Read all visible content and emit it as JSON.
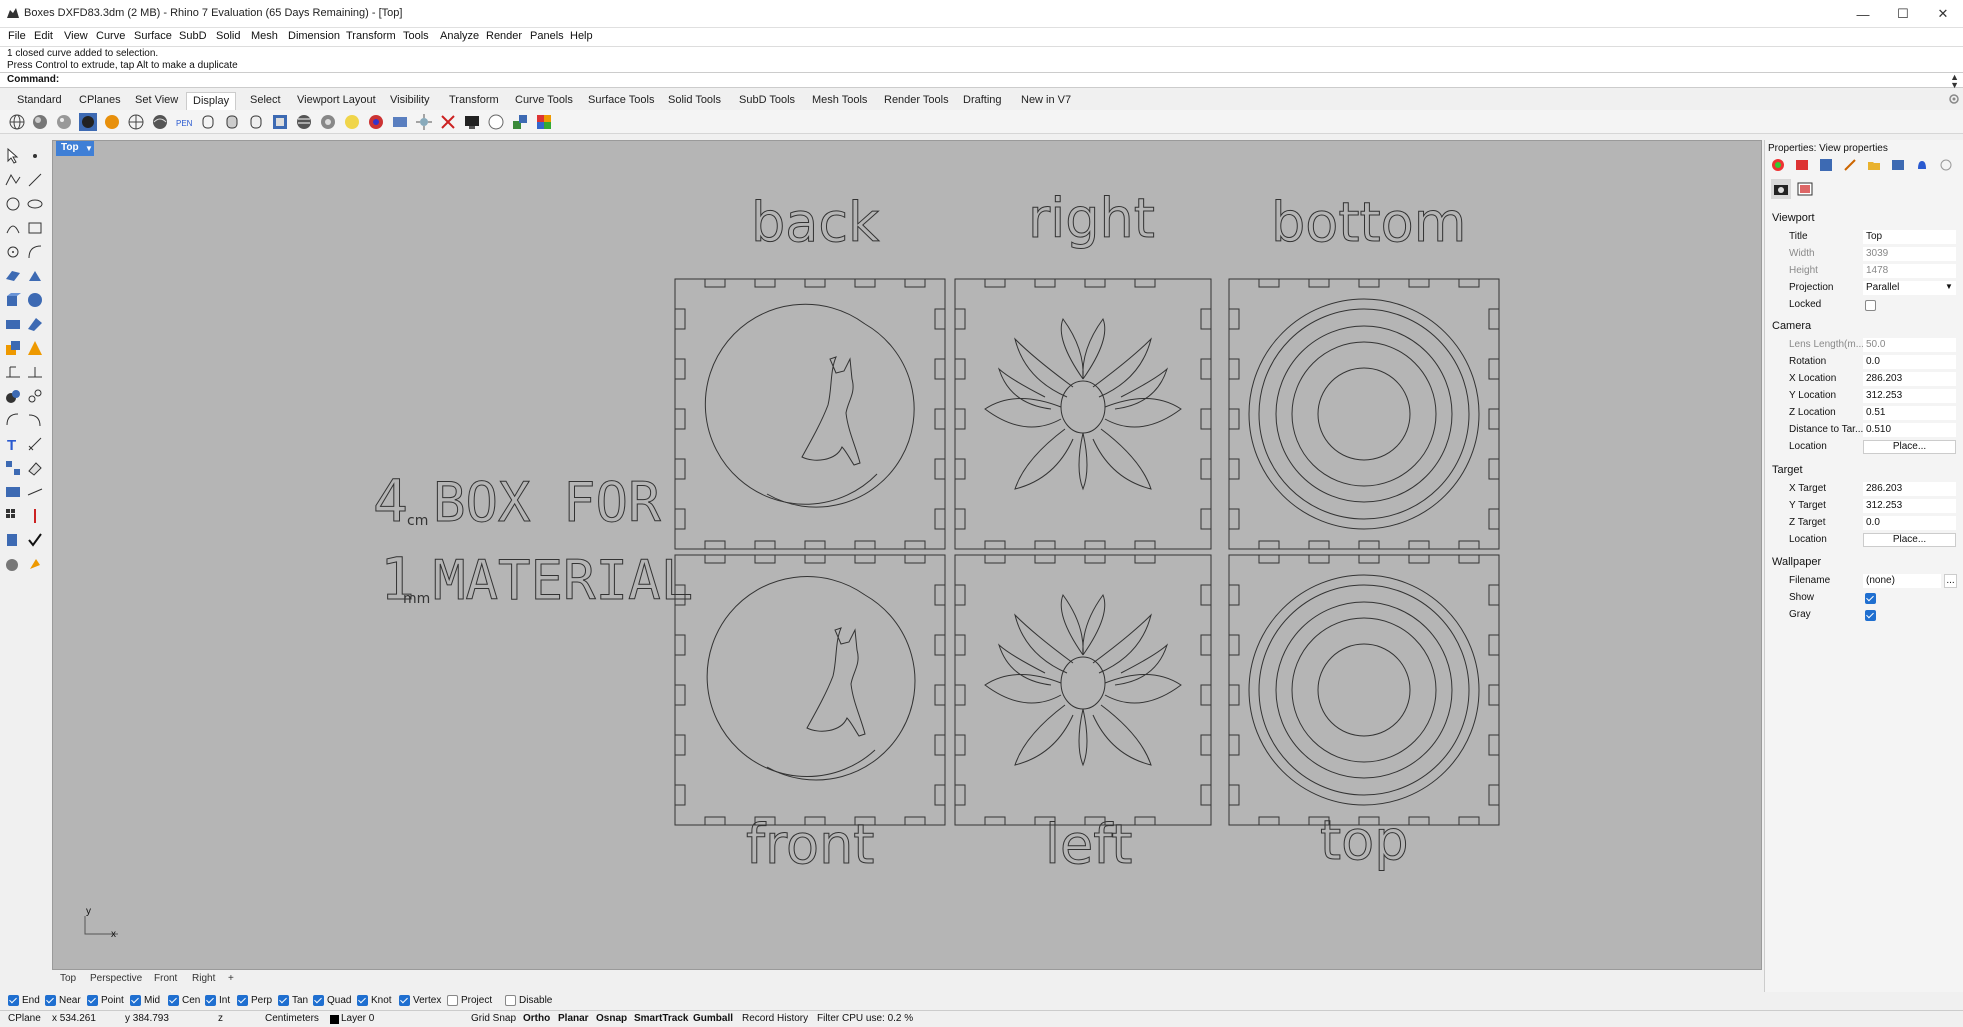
{
  "window": {
    "title": "Boxes DXFD83.3dm (2 MB) - Rhino 7 Evaluation (65 Days Remaining) - [Top]",
    "controls": {
      "minimize": "—",
      "maximize": "☐",
      "close": "✕"
    }
  },
  "menu": [
    "File",
    "Edit",
    "View",
    "Curve",
    "Surface",
    "SubD",
    "Solid",
    "Mesh",
    "Dimension",
    "Transform",
    "Tools",
    "Analyze",
    "Render",
    "Panels",
    "Help"
  ],
  "history": [
    "1 closed curve added to selection.",
    "Press Control to extrude, tap Alt to make a duplicate"
  ],
  "command": {
    "label": "Command:",
    "value": ""
  },
  "toolbar_tabs": [
    "Standard",
    "CPlanes",
    "Set View",
    "Display",
    "Select",
    "Viewport Layout",
    "Visibility",
    "Transform",
    "Curve Tools",
    "Surface Tools",
    "Solid Tools",
    "SubD Tools",
    "Mesh Tools",
    "Render Tools",
    "Drafting",
    "New in V7"
  ],
  "active_toolbar_tab": "Display",
  "toolbar_icons": [
    "wireframe-icon",
    "shaded-icon",
    "rendered-icon",
    "ghosted-icon",
    "xray-icon",
    "technical-icon",
    "artistic-icon",
    "pen-icon",
    "arctic-icon",
    "monochrome-icon",
    "toggle-shade-icon",
    "object-display-icon",
    "zebra-icon",
    "env-map-icon",
    "draft-angle-icon",
    "curvature-icon",
    "emap-icon",
    "light-icon",
    "spotlight-icon",
    "sun-icon",
    "camera-icon",
    "gumball-icon",
    "delete-view-icon",
    "display-monitor-icon",
    "capture-icon",
    "render-icon",
    "material-icon"
  ],
  "left_tools": [
    "select-icon",
    "point-icon",
    "polyline-icon",
    "line-icon",
    "circle-icon",
    "ellipse-icon",
    "arc-icon",
    "rectangle-icon",
    "polygon-icon",
    "curve-icon",
    "surface-icon",
    "loft-icon",
    "box-icon",
    "sphere-icon",
    "extrude-icon",
    "mesh-icon",
    "fillet-icon",
    "offset-icon",
    "trim-icon",
    "split-icon",
    "join-icon",
    "explode-icon",
    "boolean-icon",
    "move-icon",
    "rotate-icon",
    "scale-icon",
    "text-icon",
    "dimension-icon",
    "group-icon",
    "block-icon",
    "array-icon",
    "orient-icon",
    "layer-icon",
    "properties-icon",
    "check-icon",
    "analyze-icon",
    "render-icon",
    "paint-icon"
  ],
  "viewport": {
    "title": "Top",
    "labels": {
      "back": "back",
      "right": "right",
      "bottom": "bottom",
      "front": "front",
      "left": "left",
      "top": "top"
    },
    "box_text": {
      "n1": "4",
      "u1": "cm",
      "t1": "BOX FOR",
      "n2": "1",
      "u2": "mm",
      "t2": "MATERIAL"
    },
    "axis": {
      "y": "y",
      "x": "x"
    }
  },
  "viewport_tabs": [
    "Top",
    "Perspective",
    "Front",
    "Right"
  ],
  "viewport_add": "+",
  "snaps": [
    {
      "label": "End",
      "on": true
    },
    {
      "label": "Near",
      "on": true
    },
    {
      "label": "Point",
      "on": true
    },
    {
      "label": "Mid",
      "on": true
    },
    {
      "label": "Cen",
      "on": true
    },
    {
      "label": "Int",
      "on": true
    },
    {
      "label": "Perp",
      "on": true
    },
    {
      "label": "Tan",
      "on": true
    },
    {
      "label": "Quad",
      "on": true
    },
    {
      "label": "Knot",
      "on": true
    },
    {
      "label": "Vertex",
      "on": true
    },
    {
      "label": "Project",
      "on": false
    },
    {
      "label": "Disable",
      "on": false
    }
  ],
  "status": {
    "cplane": "CPlane",
    "x": "x 534.261",
    "y": "y 384.793",
    "z": "z",
    "units": "Centimeters",
    "layer": "Layer 0",
    "grid_snap": "Grid Snap",
    "ortho": "Ortho",
    "planar": "Planar",
    "osnap": "Osnap",
    "smarttrack": "SmartTrack",
    "gumball": "Gumball",
    "record_history": "Record History",
    "filter": "Filter",
    "cpu": "CPU use: 0.2 %"
  },
  "properties": {
    "panel_title": "Properties: View properties",
    "sections": {
      "viewport": "Viewport",
      "camera": "Camera",
      "target": "Target",
      "wallpaper": "Wallpaper"
    },
    "viewport": {
      "title_label": "Title",
      "title_value": "Top",
      "width_label": "Width",
      "width_value": "3039",
      "height_label": "Height",
      "height_value": "1478",
      "projection_label": "Projection",
      "projection_value": "Parallel",
      "locked_label": "Locked"
    },
    "camera": {
      "lens_label": "Lens Length(m...",
      "lens_value": "50.0",
      "rotation_label": "Rotation",
      "rotation_value": "0.0",
      "xloc_label": "X Location",
      "xloc_value": "286.203",
      "yloc_label": "Y Location",
      "yloc_value": "312.253",
      "zloc_label": "Z Location",
      "zloc_value": "0.51",
      "dist_label": "Distance to Tar...",
      "dist_value": "0.510",
      "loc_label": "Location",
      "loc_button": "Place..."
    },
    "target": {
      "xt_label": "X Target",
      "xt_value": "286.203",
      "yt_label": "Y Target",
      "yt_value": "312.253",
      "zt_label": "Z Target",
      "zt_value": "0.0",
      "loc_label": "Location",
      "loc_button": "Place..."
    },
    "wallpaper": {
      "filename_label": "Filename",
      "filename_value": "(none)",
      "browse": "...",
      "show_label": "Show",
      "gray_label": "Gray"
    }
  },
  "colors": {
    "viewport_bg": "#b5b5b5",
    "accent": "#3f7fd6",
    "check": "#1f6fd0"
  }
}
